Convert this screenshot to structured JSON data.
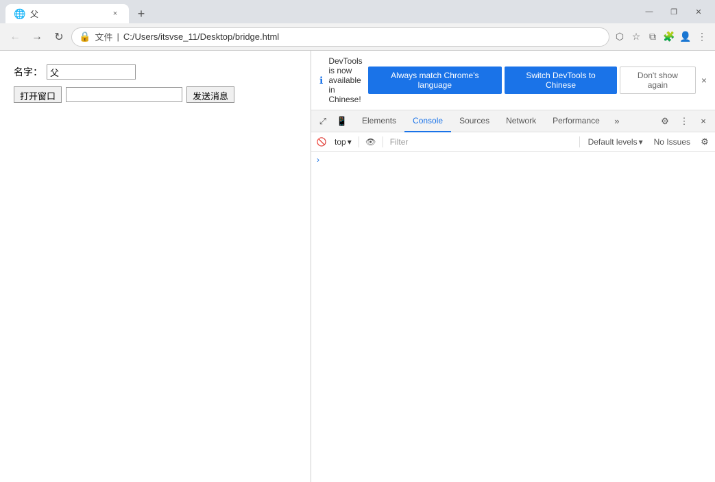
{
  "browser": {
    "tab": {
      "favicon": "🌐",
      "title": "父",
      "close_icon": "×"
    },
    "new_tab_icon": "+",
    "window_controls": {
      "minimize": "—",
      "maximize": "❐",
      "close": "✕"
    },
    "nav": {
      "back_icon": "←",
      "forward_icon": "→",
      "refresh_icon": "↻",
      "address_secure_icon": "🔒",
      "address_label": "文件",
      "address_url": "C:/Users/itsvse_11/Desktop/bridge.html",
      "bookmark_icon": "☆",
      "extensions_icon": "🧩",
      "profile_icon": "👤",
      "menu_icon": "⋮",
      "cast_icon": "⬡",
      "split_icon": "⧉"
    }
  },
  "page": {
    "label_name": "名字：",
    "input_name_value": "父",
    "button_open": "打开窗口",
    "input_message_value": "",
    "button_send": "发送消息"
  },
  "devtools": {
    "notification": {
      "icon": "ℹ",
      "text": "DevTools is now available in Chinese!",
      "btn_match": "Always match Chrome's language",
      "btn_switch": "Switch DevTools to Chinese",
      "btn_dismiss": "Don't show again",
      "close_icon": "×"
    },
    "tabs": {
      "inspect_icon": "⤢",
      "device_icon": "📱",
      "items": [
        "Elements",
        "Console",
        "Sources",
        "Network",
        "Performance"
      ],
      "more_icon": "»",
      "active": "Console",
      "settings_icon": "⚙",
      "more_options_icon": "⋮",
      "close_icon": "×"
    },
    "console_toolbar": {
      "clear_icon": "🚫",
      "top_label": "top",
      "dropdown_icon": "▾",
      "eye_icon": "👁",
      "filter_placeholder": "Filter",
      "default_levels_label": "Default levels",
      "dropdown2_icon": "▾",
      "no_issues": "No Issues",
      "gear_icon": "⚙"
    },
    "console_content": {
      "arrow": "›"
    }
  }
}
